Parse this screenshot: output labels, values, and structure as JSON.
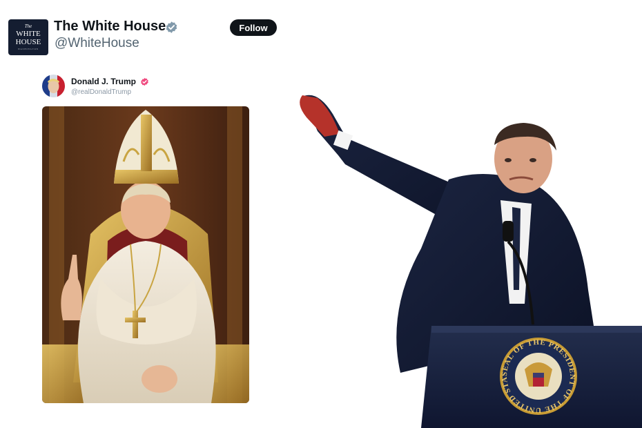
{
  "account": {
    "avatar_lines": [
      "The",
      "WHITE",
      "HOUSE",
      "WASHINGTON"
    ],
    "display_name": "The White House",
    "handle": "@WhiteHouse",
    "follow_label": "Follow",
    "verified_icon": "verified-badge-icon",
    "colors": {
      "avatar_bg": "#141d31",
      "badge": "#829aab",
      "follow_bg": "#0f1419"
    }
  },
  "embedded_post": {
    "author_name": "Donald J. Trump",
    "author_handle": "@realDonaldTrump",
    "badge_icon": "verified-badge-icon",
    "badge_color": "#f0497f",
    "image_description_icon": "pope-portrait-image"
  },
  "right_image": {
    "seal_ring_text": "SEAL OF THE PRESIDENT OF THE UNITED STATES",
    "image_icon": "podium-speaker-image"
  }
}
